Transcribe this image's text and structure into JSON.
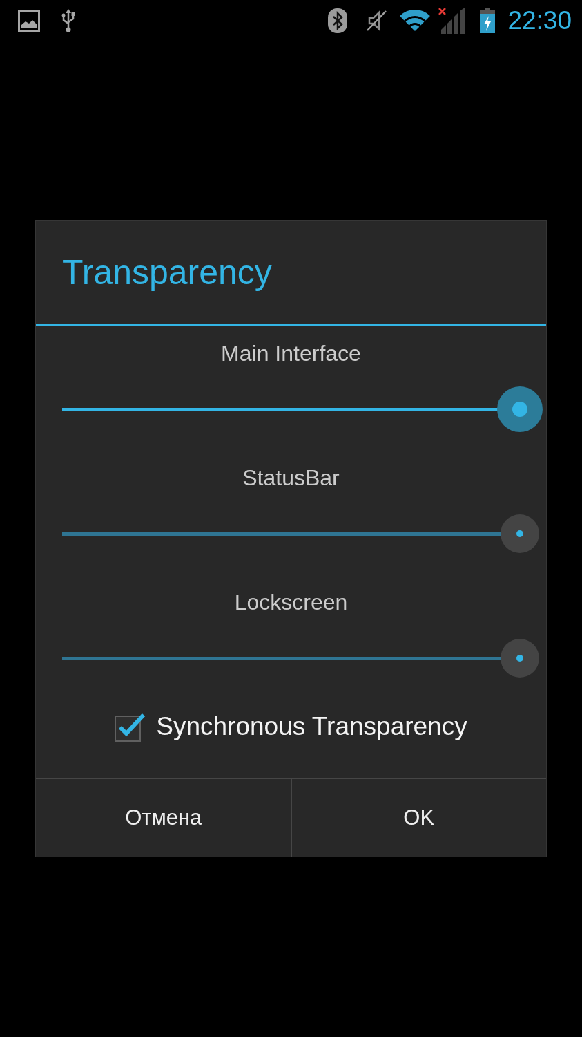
{
  "status_bar": {
    "time": "22:30"
  },
  "dialog": {
    "title": "Transparency",
    "sliders": [
      {
        "label": "Main Interface",
        "level": 1,
        "focused": true
      },
      {
        "label": "StatusBar",
        "level": 1,
        "focused": false
      },
      {
        "label": "Lockscreen",
        "level": 1,
        "focused": false
      }
    ],
    "checkbox": {
      "label": "Synchronous Transparency",
      "checked": true
    },
    "buttons": [
      {
        "label": "Отмена"
      },
      {
        "label": "OK"
      }
    ]
  }
}
